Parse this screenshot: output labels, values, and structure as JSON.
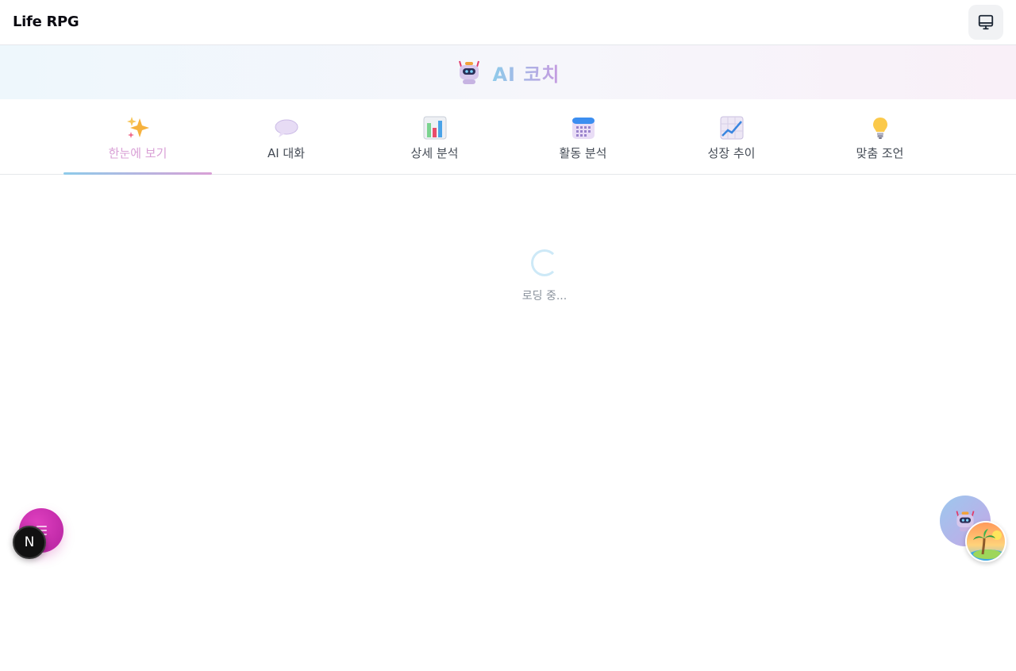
{
  "app": {
    "title": "Life RPG"
  },
  "header": {
    "device_icon": "monitor-icon"
  },
  "hero": {
    "icon": "robot-icon",
    "title": "AI 코치"
  },
  "tabs": [
    {
      "label": "한눈에 보기",
      "icon": "sparkles-icon",
      "active": true
    },
    {
      "label": "AI 대화",
      "icon": "speech-bubble-icon",
      "active": false
    },
    {
      "label": "상세 분석",
      "icon": "bar-chart-icon",
      "active": false
    },
    {
      "label": "활동 분석",
      "icon": "calendar-icon",
      "active": false
    },
    {
      "label": "성장 추이",
      "icon": "trend-up-chart-icon",
      "active": false
    },
    {
      "label": "맞춤 조언",
      "icon": "light-bulb-icon",
      "active": false
    }
  ],
  "loading": {
    "text": "로딩 중..."
  },
  "floating": {
    "menu_icon": "menu-icon",
    "next_badge_label": "N",
    "coach_icon": "robot-icon",
    "island_icon": "island-icon"
  },
  "colors": {
    "accent_blue": "#8ecbea",
    "accent_pink": "#d9a0d6",
    "fab_magenta": "#d033b4"
  }
}
